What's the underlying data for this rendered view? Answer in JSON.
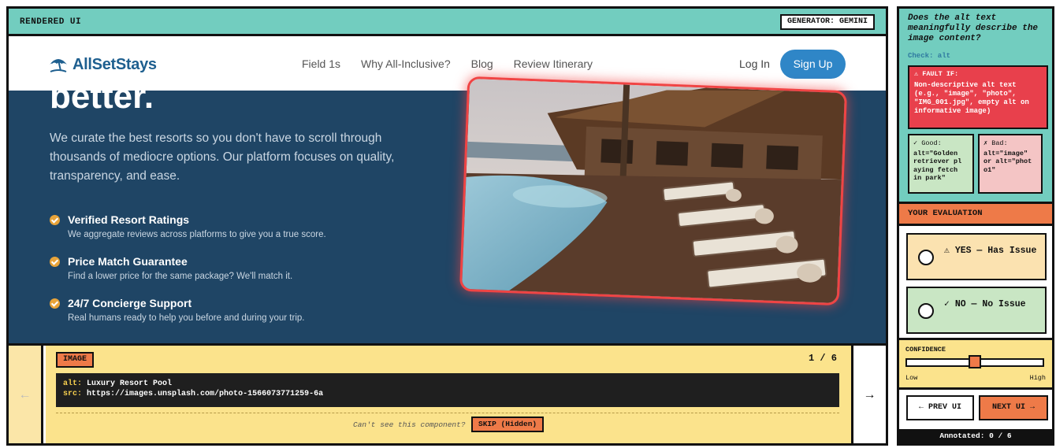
{
  "topbar": {
    "title": "RENDERED UI",
    "generator": "GENERATOR: GEMINI"
  },
  "site": {
    "logo": "AllSetStays",
    "nav": [
      "Field 1s",
      "Why All-Inclusive?",
      "Blog",
      "Review Itinerary"
    ],
    "login": "Log In",
    "signup": "Sign Up"
  },
  "hero": {
    "title": "better.",
    "text": "We curate the best resorts so you don't have to scroll through thousands of mediocre options. Our platform focuses on quality, transparency, and ease.",
    "features": [
      {
        "title": "Verified Resort Ratings",
        "desc": "We aggregate reviews across platforms to give you a true score."
      },
      {
        "title": "Price Match Guarantee",
        "desc": "Find a lower price for the same package? We'll match it."
      },
      {
        "title": "24/7 Concierge Support",
        "desc": "Real humans ready to help you before and during your trip."
      }
    ]
  },
  "inspector": {
    "tag": "IMAGE",
    "counter": "1 / 6",
    "alt_key": "alt:",
    "alt_value": "Luxury Resort Pool",
    "src_key": "src:",
    "src_value": "https://images.unsplash.com/photo-1566073771259-6a",
    "cant_see": "Can't see this component?",
    "skip": "SKIP (Hidden)",
    "prev_arrow": "←",
    "next_arrow": "→"
  },
  "panel": {
    "question": "Does the alt text meaningfully describe the image content?",
    "check": "Check: alt",
    "fault_header": "⚠ FAULT IF:",
    "fault_body": "Non-descriptive alt text (e.g., \"image\", \"photo\", \"IMG_001.jpg\", empty alt on informative image)",
    "good_header": "✓ Good:",
    "good_body": "alt=\"Golden retriever pl aying fetch in park\"",
    "bad_header": "✗ Bad:",
    "bad_body": "alt=\"image\" or alt=\"phot o1\"",
    "eval_header": "YOUR EVALUATION",
    "yes_label": "⚠ YES — Has Issue",
    "no_label": "✓ NO — No Issue",
    "confidence_label": "CONFIDENCE",
    "confidence_low": "Low",
    "confidence_high": "High",
    "confidence_value": 0.5,
    "prev_btn": "← PREV UI",
    "next_btn": "NEXT UI →",
    "annotated": "Annotated: 0 / 6"
  },
  "colors": {
    "teal": "#72cdbf",
    "navy": "#1f4565",
    "orange": "#ee7a48",
    "yellow": "#fbe38c",
    "red": "#e8404c",
    "brand_blue": "#2f86c7"
  }
}
